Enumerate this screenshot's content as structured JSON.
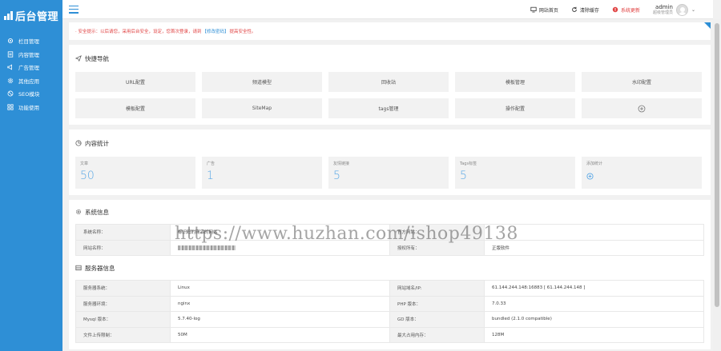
{
  "sidebar": {
    "logo": "后台管理",
    "items": [
      {
        "label": "栏目管理",
        "icon": "gear-icon"
      },
      {
        "label": "内容管理",
        "icon": "document-icon"
      },
      {
        "label": "广告管理",
        "icon": "megaphone-icon"
      },
      {
        "label": "其他应用",
        "icon": "settings-icon"
      },
      {
        "label": "SEO模块",
        "icon": "seo-icon"
      },
      {
        "label": "功能使用",
        "icon": "grid-icon"
      }
    ]
  },
  "topbar": {
    "site_home": "网站首页",
    "clear_cache": "清除缓存",
    "system_update": "系统更新",
    "username": "admin",
    "user_role": "超级管理员"
  },
  "alert": {
    "before": "· 安全提示：以后请您，采用后台安全，设定，您首次登录，请到",
    "link": "【修改密码】",
    "after": "提高安全性。"
  },
  "quick_nav": {
    "title": "快捷导航",
    "items": [
      "URL配置",
      "频道模型",
      "回收站",
      "模板管理",
      "水印配置",
      "模板配置",
      "SiteMap",
      "tags管理",
      "操作配置"
    ]
  },
  "content_stats": {
    "title": "内容统计",
    "items": [
      {
        "label": "文章",
        "value": "50"
      },
      {
        "label": "广告",
        "value": "1"
      },
      {
        "label": "友情链接",
        "value": "5"
      },
      {
        "label": "Tags标签",
        "value": "5"
      },
      {
        "label": "添加统计",
        "value": ""
      }
    ]
  },
  "system_info": {
    "title": "系统信息",
    "rows": [
      {
        "k1": "系统名称：",
        "v1": "标识码的商品的网站",
        "k2": "官方网站：",
        "v2": ""
      },
      {
        "k1": "网站名称：",
        "v1": "",
        "k2": "授权所有：",
        "v2": "正版软件"
      }
    ]
  },
  "server_info": {
    "title": "服务器信息",
    "rows": [
      {
        "k1": "服务器系统：",
        "v1": "Linux",
        "k2": "网站域名/IP:",
        "v2": "61.144.244.148:16883 [ 61.144.244.148 ]"
      },
      {
        "k1": "服务器环境：",
        "v1": "nginx",
        "k2": "PHP 版本：",
        "v2": "7.0.33"
      },
      {
        "k1": "Mysql 版本：",
        "v1": "5.7.40-log",
        "k2": "GD 版本：",
        "v2": "bundled (2.1.0 compatible)"
      },
      {
        "k1": "文件上传限制：",
        "v1": "50M",
        "k2": "最大占用内存：",
        "v2": "128M"
      }
    ]
  },
  "watermark": "https://www.huzhan.com/ishop49138",
  "colors": {
    "primary": "#2e8fd6",
    "alert": "#e04040",
    "stat_number": "#5aa8e6"
  }
}
